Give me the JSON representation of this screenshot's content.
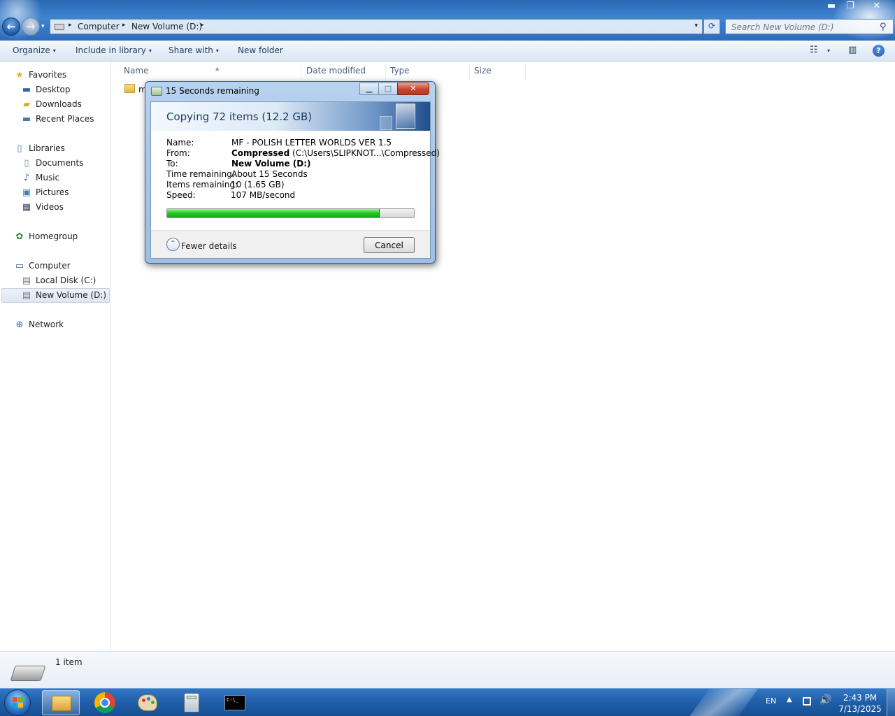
{
  "window": {
    "controls": {
      "minimize": "▬",
      "restore": "❐",
      "close": "✕"
    }
  },
  "nav": {
    "back_glyph": "←",
    "forward_glyph": "→",
    "menu_glyph": "▾"
  },
  "address": {
    "crumbs": [
      "Computer",
      "New Volume (D:)"
    ],
    "separator": "▸",
    "dropdown_glyph": "▾",
    "refresh_glyph": "⟳"
  },
  "search": {
    "placeholder": "Search New Volume (D:)",
    "icon_glyph": "⚲"
  },
  "toolbar": {
    "organize": "Organize",
    "include_in_library": "Include in library",
    "share_with": "Share with",
    "new_folder": "New folder",
    "caret": "▾",
    "view_glyph": "☷",
    "preview_glyph": "▥",
    "help_glyph": "?"
  },
  "sidebar": {
    "favorites": {
      "label": "Favorites",
      "items": [
        "Desktop",
        "Downloads",
        "Recent Places"
      ]
    },
    "libraries": {
      "label": "Libraries",
      "items": [
        "Documents",
        "Music",
        "Pictures",
        "Videos"
      ]
    },
    "homegroup": "Homegroup",
    "computer": {
      "label": "Computer",
      "items": [
        "Local Disk (C:)",
        "New Volume (D:)"
      ],
      "selected": "New Volume (D:)"
    },
    "network": "Network",
    "glyphs": {
      "star": "★",
      "desktop": "▬",
      "folder": "▰",
      "music": "♪",
      "picture": "▣",
      "video": "▦",
      "homegroup": "✿",
      "computer": "▭",
      "disk": "▤",
      "network": "⊕",
      "library": "▯"
    }
  },
  "filelist": {
    "columns": [
      "Name",
      "Date modified",
      "Type",
      "Size"
    ],
    "sort_glyph": "▲",
    "rows": [
      {
        "name": "m"
      }
    ]
  },
  "details": {
    "count": "1 item"
  },
  "dialog": {
    "title": "15 Seconds remaining",
    "heading": "Copying 72 items (12.2 GB)",
    "fields": {
      "name_label": "Name:",
      "name_value": "MF - POLISH LETTER WORLDS VER 1.5",
      "from_label": "From:",
      "from_bold": "Compressed",
      "from_rest": "(C:\\Users\\SLIPKNOT...\\Compressed)",
      "to_label": "To:",
      "to_value": "New Volume (D:)",
      "time_label": "Time remaining:",
      "time_value": "About 15 Seconds",
      "items_label": "Items remaining:",
      "items_value": "10 (1.65 GB)",
      "speed_label": "Speed:",
      "speed_value": "107 MB/second"
    },
    "progress_fraction": 0.86,
    "progress_color": "#28c828",
    "fewer_details": "Fewer details",
    "fewer_glyph": "⌃",
    "cancel": "Cancel",
    "controls": {
      "minimize": "▁",
      "maximize": "□",
      "close": "✕"
    }
  },
  "taskbar": {
    "language": "EN",
    "tray_up_glyph": "▲",
    "volume_glyph": "🔊",
    "time": "2:43 PM",
    "date": "7/13/2025",
    "cmd_text": "C:\\_"
  }
}
